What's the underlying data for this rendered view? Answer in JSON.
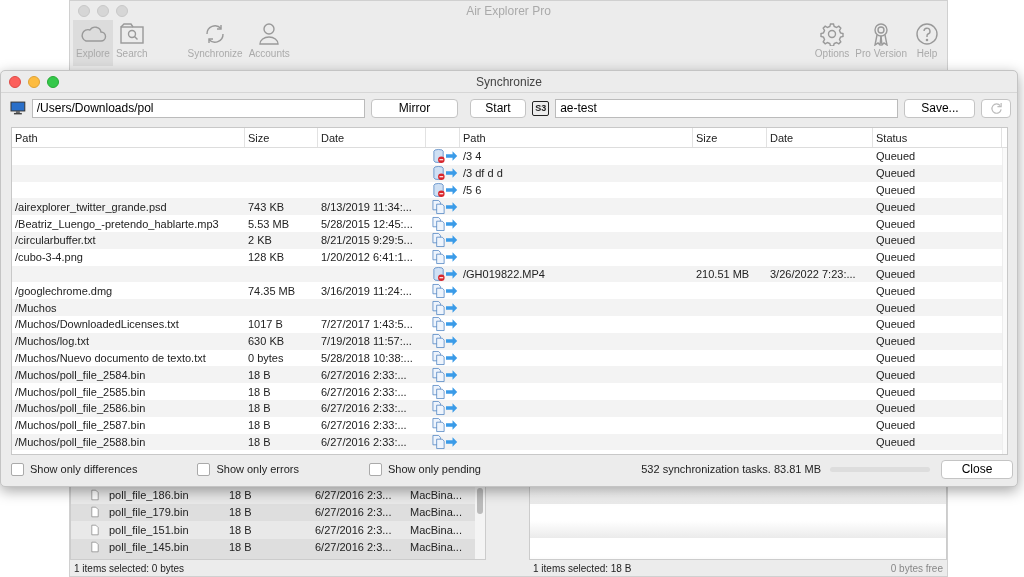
{
  "main_window": {
    "title": "Air Explorer Pro",
    "toolbar_left": [
      {
        "label": "Explore",
        "kind": "cloud",
        "selected": true
      },
      {
        "label": "Search",
        "kind": "search",
        "selected": false
      },
      {
        "label": "Synchronize",
        "kind": "sync",
        "selected": false
      },
      {
        "label": "Accounts",
        "kind": "person",
        "selected": false
      }
    ],
    "toolbar_right": [
      {
        "label": "Options",
        "kind": "gear"
      },
      {
        "label": "Pro Version",
        "kind": "ribbon"
      },
      {
        "label": "Help",
        "kind": "help"
      }
    ],
    "file_list": [
      {
        "name": "poll_file_186.bin",
        "size": "18 B",
        "date": "6/27/2016 2:3...",
        "kind": "MacBina..."
      },
      {
        "name": "poll_file_179.bin",
        "size": "18 B",
        "date": "6/27/2016 2:3...",
        "kind": "MacBina..."
      },
      {
        "name": "poll_file_151.bin",
        "size": "18 B",
        "date": "6/27/2016 2:3...",
        "kind": "MacBina..."
      },
      {
        "name": "poll_file_145.bin",
        "size": "18 B",
        "date": "6/27/2016 2:3...",
        "kind": "MacBina..."
      }
    ],
    "left_status": "1 items selected: 0 bytes",
    "right_status": "1 items selected: 18 B",
    "free_space": "0 bytes free"
  },
  "sync_dialog": {
    "title": "Synchronize",
    "local_path": "/Users/Downloads/pol",
    "mode_button": "Mirror",
    "start_button": "Start",
    "remote_badge": "S3",
    "remote_path": "ae-test",
    "save_button": "Save...",
    "left_columns": [
      "Path",
      "Size",
      "Date"
    ],
    "right_columns": [
      "Path",
      "Size",
      "Date",
      "Status"
    ],
    "rows": [
      {
        "left_path": "",
        "left_size": "",
        "left_date": "",
        "kind": "delete",
        "right_path": "/3 4",
        "right_size": "",
        "right_date": "",
        "status": "Queued"
      },
      {
        "left_path": "",
        "left_size": "",
        "left_date": "",
        "kind": "delete",
        "right_path": "/3 df d d",
        "right_size": "",
        "right_date": "",
        "status": "Queued"
      },
      {
        "left_path": "",
        "left_size": "",
        "left_date": "",
        "kind": "delete",
        "right_path": "/5 6",
        "right_size": "",
        "right_date": "",
        "status": "Queued"
      },
      {
        "left_path": "/airexplorer_twitter_grande.psd",
        "left_size": "743 KB",
        "left_date": "8/13/2019 11:34:...",
        "kind": "copy",
        "right_path": "",
        "right_size": "",
        "right_date": "",
        "status": "Queued"
      },
      {
        "left_path": "/Beatriz_Luengo_-pretendo_hablarte.mp3",
        "left_size": "5.53 MB",
        "left_date": "5/28/2015 12:45:...",
        "kind": "copy",
        "right_path": "",
        "right_size": "",
        "right_date": "",
        "status": "Queued"
      },
      {
        "left_path": "/circularbuffer.txt",
        "left_size": "2 KB",
        "left_date": "8/21/2015 9:29:5...",
        "kind": "copy",
        "right_path": "",
        "right_size": "",
        "right_date": "",
        "status": "Queued"
      },
      {
        "left_path": "/cubo-3-4.png",
        "left_size": "128 KB",
        "left_date": "1/20/2012 6:41:1...",
        "kind": "copy",
        "right_path": "",
        "right_size": "",
        "right_date": "",
        "status": "Queued"
      },
      {
        "left_path": "",
        "left_size": "",
        "left_date": "",
        "kind": "delete",
        "right_path": "/GH019822.MP4",
        "right_size": "210.51 MB",
        "right_date": "3/26/2022 7:23:...",
        "status": "Queued"
      },
      {
        "left_path": "/googlechrome.dmg",
        "left_size": "74.35 MB",
        "left_date": "3/16/2019 11:24:...",
        "kind": "copy",
        "right_path": "",
        "right_size": "",
        "right_date": "",
        "status": "Queued"
      },
      {
        "left_path": "/Muchos",
        "left_size": "",
        "left_date": "",
        "kind": "copy",
        "right_path": "",
        "right_size": "",
        "right_date": "",
        "status": "Queued"
      },
      {
        "left_path": "/Muchos/DownloadedLicenses.txt",
        "left_size": "1017 B",
        "left_date": "7/27/2017 1:43:5...",
        "kind": "copy",
        "right_path": "",
        "right_size": "",
        "right_date": "",
        "status": "Queued"
      },
      {
        "left_path": "/Muchos/log.txt",
        "left_size": "630 KB",
        "left_date": "7/19/2018 11:57:...",
        "kind": "copy",
        "right_path": "",
        "right_size": "",
        "right_date": "",
        "status": "Queued"
      },
      {
        "left_path": "/Muchos/Nuevo documento de texto.txt",
        "left_size": "0 bytes",
        "left_date": "5/28/2018 10:38:...",
        "kind": "copy",
        "right_path": "",
        "right_size": "",
        "right_date": "",
        "status": "Queued"
      },
      {
        "left_path": "/Muchos/poll_file_2584.bin",
        "left_size": "18 B",
        "left_date": "6/27/2016 2:33:...",
        "kind": "copy",
        "right_path": "",
        "right_size": "",
        "right_date": "",
        "status": "Queued"
      },
      {
        "left_path": "/Muchos/poll_file_2585.bin",
        "left_size": "18 B",
        "left_date": "6/27/2016 2:33:...",
        "kind": "copy",
        "right_path": "",
        "right_size": "",
        "right_date": "",
        "status": "Queued"
      },
      {
        "left_path": "/Muchos/poll_file_2586.bin",
        "left_size": "18 B",
        "left_date": "6/27/2016 2:33:...",
        "kind": "copy",
        "right_path": "",
        "right_size": "",
        "right_date": "",
        "status": "Queued"
      },
      {
        "left_path": "/Muchos/poll_file_2587.bin",
        "left_size": "18 B",
        "left_date": "6/27/2016 2:33:...",
        "kind": "copy",
        "right_path": "",
        "right_size": "",
        "right_date": "",
        "status": "Queued"
      },
      {
        "left_path": "/Muchos/poll_file_2588.bin",
        "left_size": "18 B",
        "left_date": "6/27/2016 2:33:...",
        "kind": "copy",
        "right_path": "",
        "right_size": "",
        "right_date": "",
        "status": "Queued"
      }
    ],
    "filters": [
      {
        "label": "Show only differences",
        "checked": false
      },
      {
        "label": "Show only errors",
        "checked": false
      },
      {
        "label": "Show only pending",
        "checked": false
      }
    ],
    "summary": "532 synchronization tasks. 83.81 MB",
    "progress": {
      "level": 0
    },
    "close_button": "Close"
  }
}
